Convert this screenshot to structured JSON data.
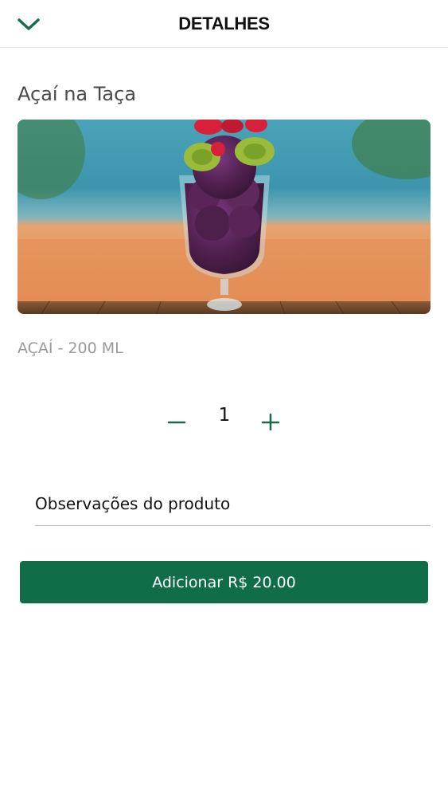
{
  "header": {
    "title": "DETALHES",
    "back_icon": "chevron-down-icon"
  },
  "product": {
    "name": "Açaí na Taça",
    "description": "AÇAÍ - 200 ML",
    "image_icon": "acai-bowl-photo"
  },
  "quantity": {
    "value": "1",
    "minus_icon": "minus-icon",
    "plus_icon": "plus-icon"
  },
  "notes": {
    "placeholder": "Observações do produto",
    "value": ""
  },
  "add_button": {
    "label": "Adicionar R$ 20.00"
  },
  "colors": {
    "accent": "#0f6e48",
    "icon_green": "#1a6b4a",
    "divider": "#e3e3e3"
  }
}
